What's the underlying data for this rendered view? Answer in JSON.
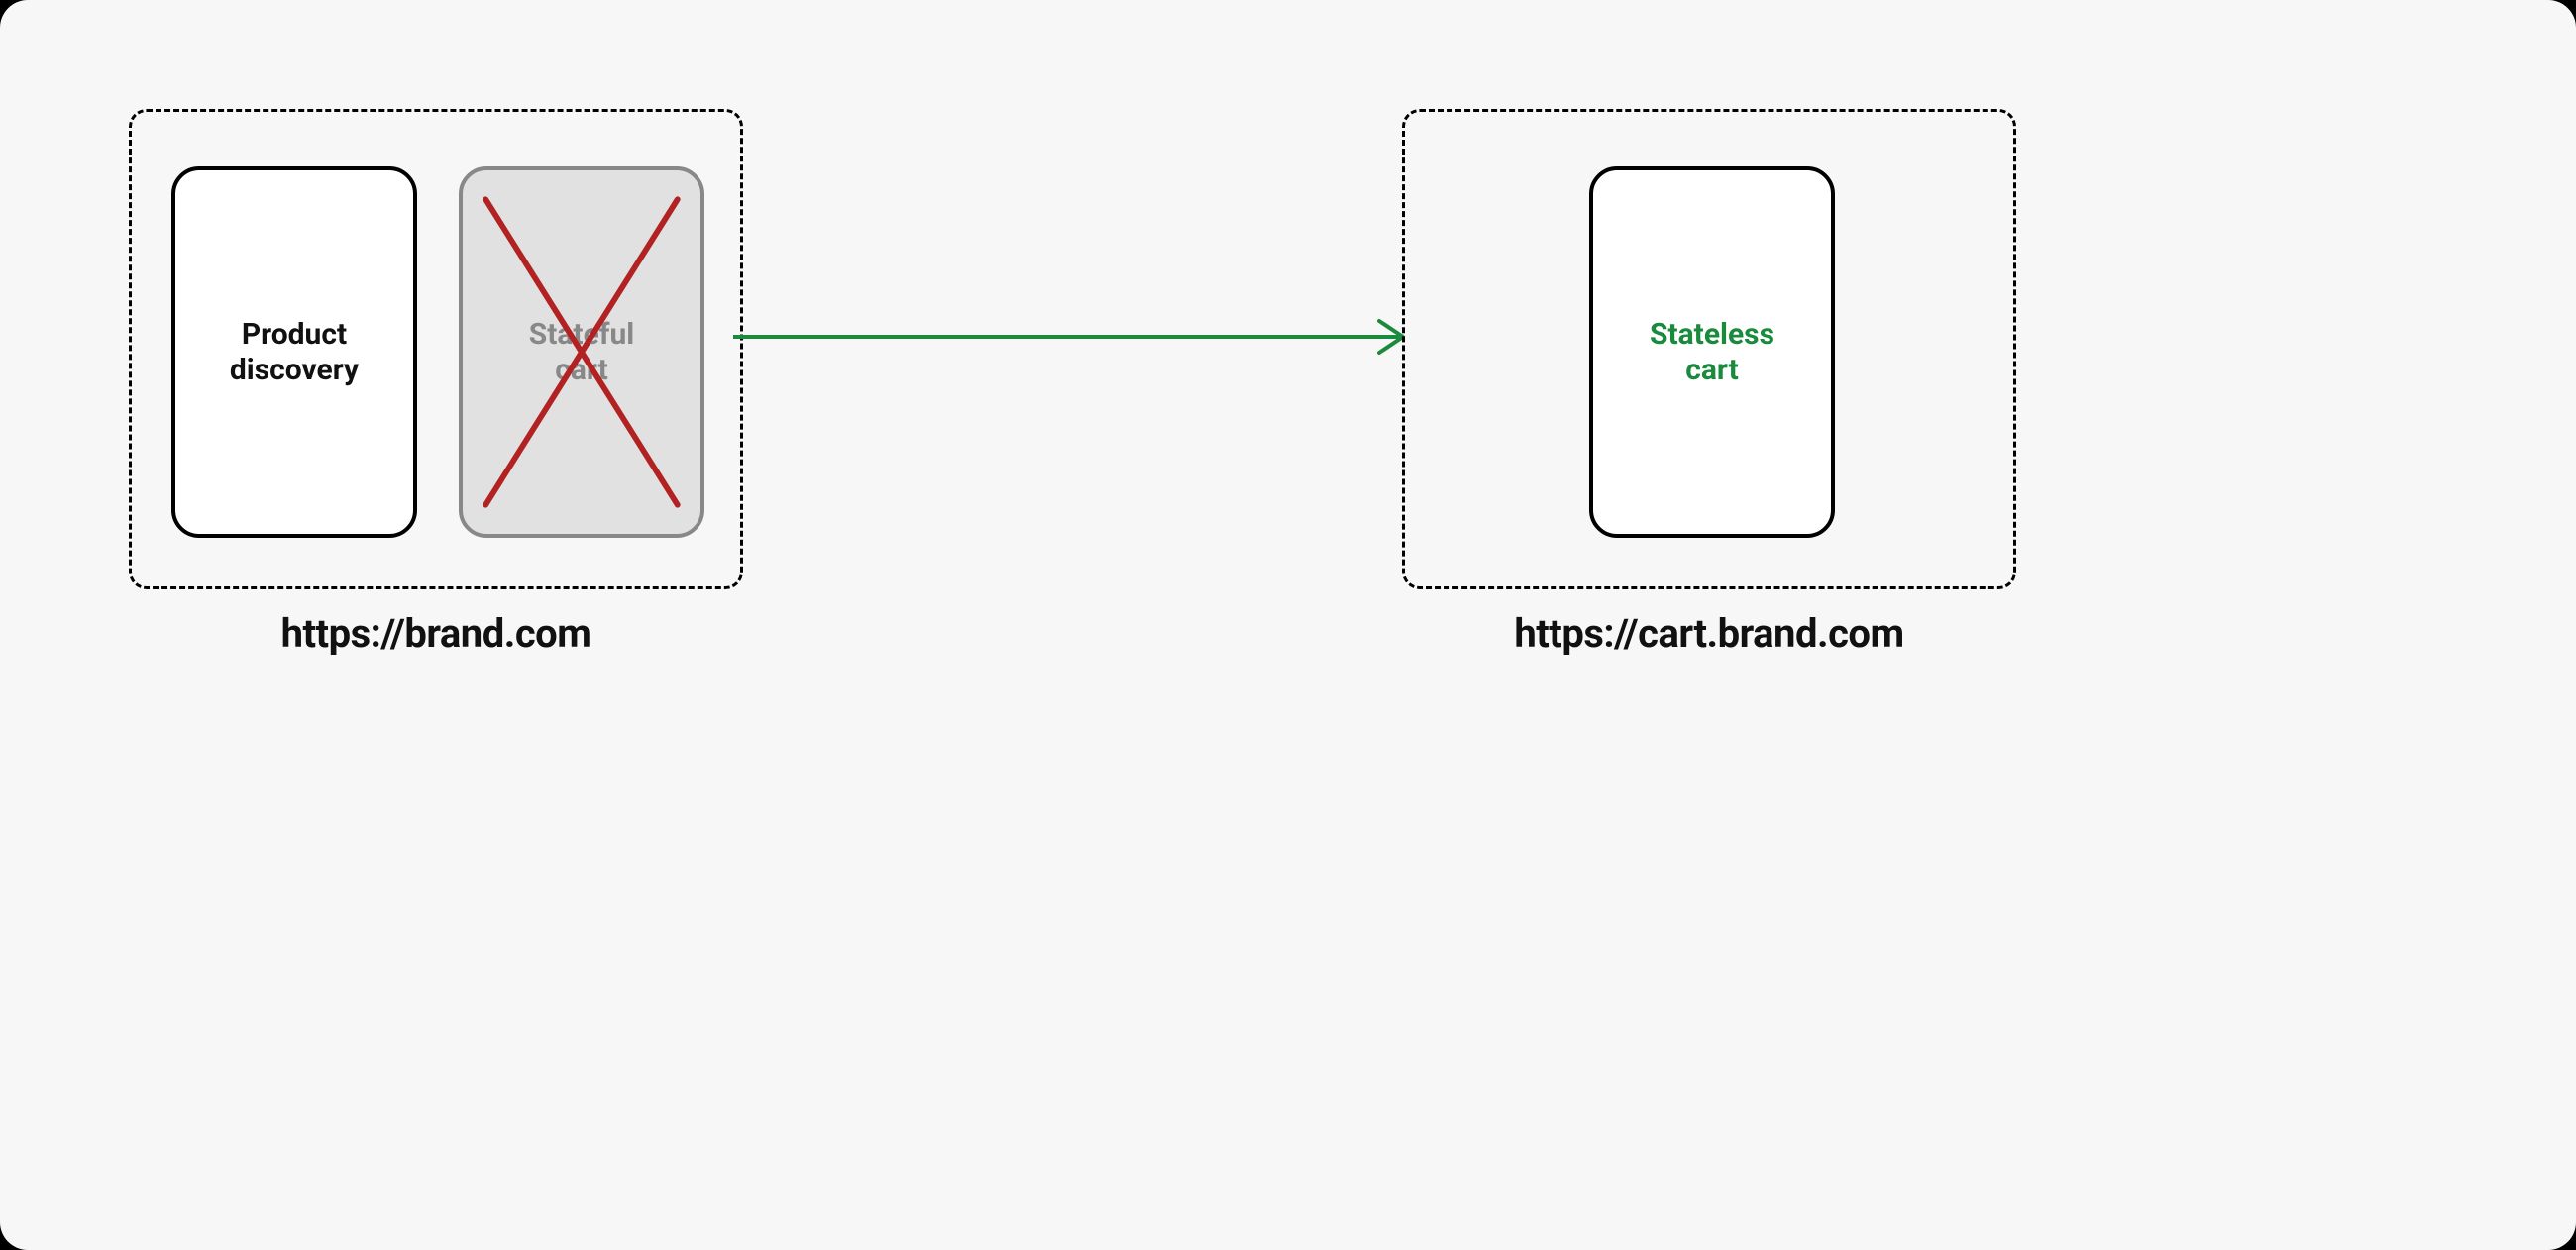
{
  "left_zone": {
    "url_label": "https://brand.com",
    "card_product": "Product\ndiscovery",
    "card_stateful": "Stateful\ncart"
  },
  "right_zone": {
    "url_label": "https://cart.brand.com",
    "card_stateless": "Stateless\ncart"
  },
  "colors": {
    "cross": "#b22222",
    "arrow": "#1a8a3d",
    "stateless_text": "#1a8a3d",
    "stateful_text": "#888888"
  }
}
